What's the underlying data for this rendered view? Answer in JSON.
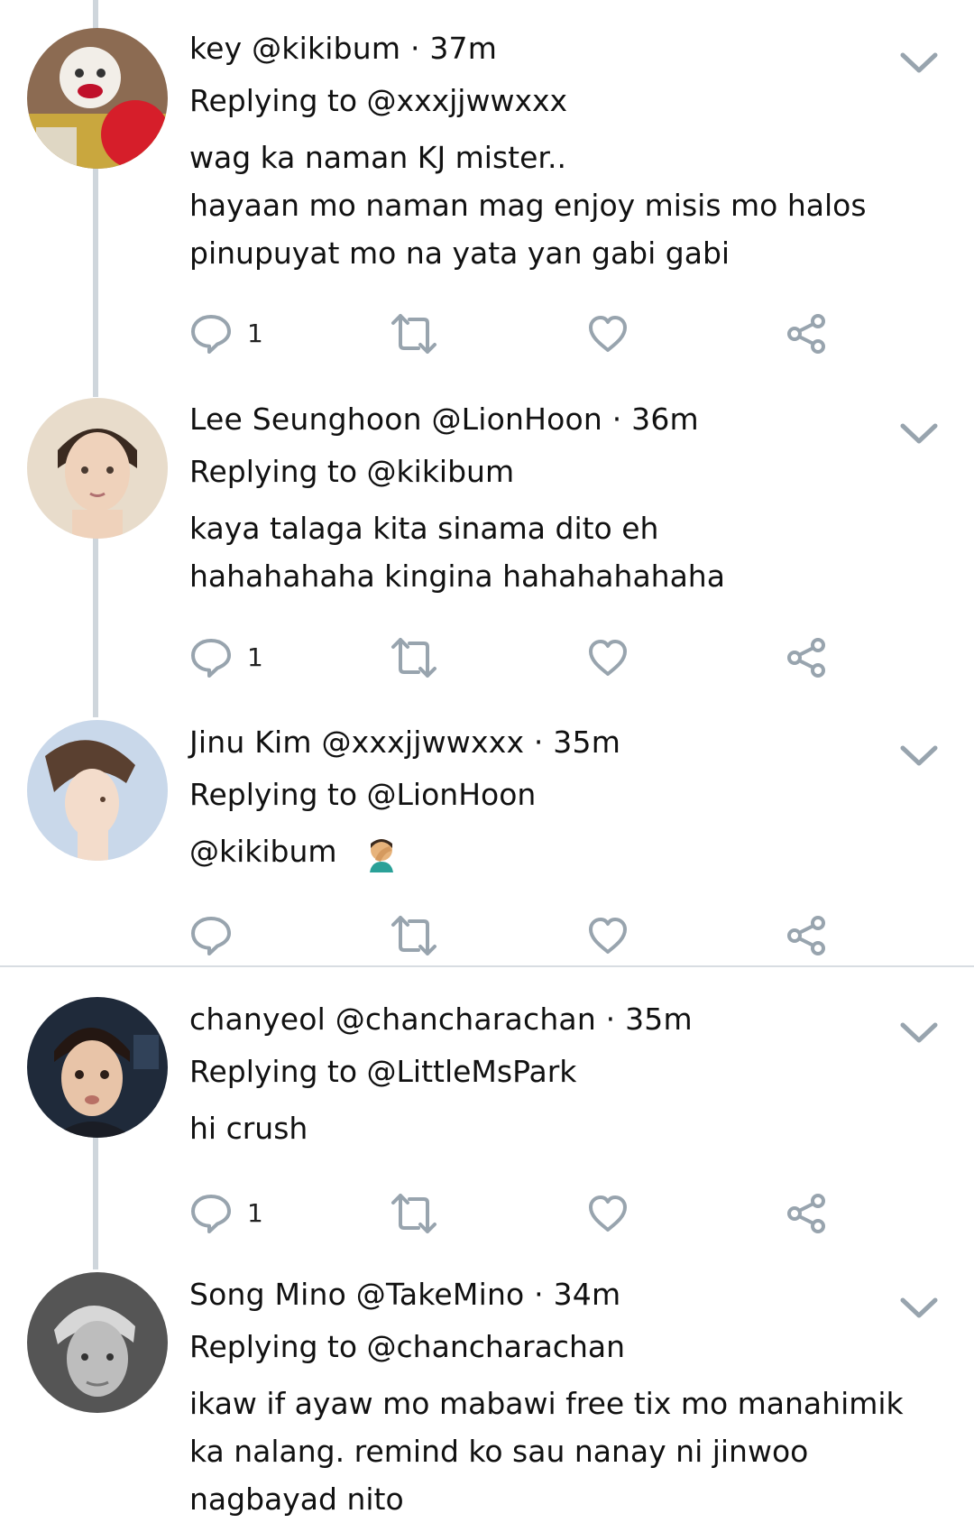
{
  "tweets": [
    {
      "display_name": "key",
      "handle": "@kikibum",
      "time": "37m",
      "replying": "Replying to @xxxjjwwxxx",
      "lines": [
        "wag ka naman KJ mister..",
        "hayaan mo naman mag enjoy misis mo halos",
        "pinupuyat mo na yata yan gabi gabi"
      ],
      "reply_count": "1"
    },
    {
      "display_name": "Lee Seunghoon",
      "handle": "@LionHoon",
      "time": "36m",
      "replying": "Replying to @kikibum",
      "lines": [
        "kaya talaga kita sinama dito eh",
        "hahahahaha kingina hahahahahaha"
      ],
      "reply_count": "1"
    },
    {
      "display_name": "Jinu Kim",
      "handle": "@xxxjjwwxxx",
      "time": "35m",
      "replying": "Replying to @LionHoon",
      "lines": [
        "@kikibum"
      ],
      "emoji": "🤦",
      "reply_count": ""
    },
    {
      "display_name": "chanyeol",
      "handle": "@chancharachan",
      "time": "35m",
      "replying": "Replying to @LittleMsPark",
      "lines": [
        "hi crush"
      ],
      "reply_count": "1"
    },
    {
      "display_name": "Song Mino",
      "handle": "@TakeMino",
      "time": "34m",
      "replying": "Replying to @chancharachan",
      "lines": [
        "ikaw if ayaw mo mabawi free tix mo manahimik",
        "ka nalang. remind ko sau nanay ni jinwoo",
        "nagbayad nito"
      ]
    }
  ],
  "separator": "·",
  "colors": {
    "text": "#111111",
    "icon": "#98a4ae",
    "thread_line": "#cfd6dc",
    "divider": "#d8dde2"
  },
  "icons": {
    "reply": "speech-bubble-icon",
    "retweet": "retweet-icon",
    "like": "heart-icon",
    "share": "share-icon",
    "menu": "chevron-down-icon"
  }
}
